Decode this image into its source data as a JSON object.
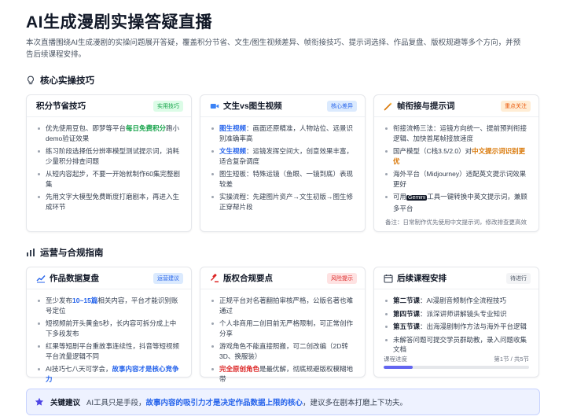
{
  "header": {
    "title": "AI生成漫剧实操答疑直播",
    "description": "本次直播围绕AI生成漫剧的实操问题展开答疑，覆盖积分节省、文生/图生视频差异、帧衔接技巧、提示词选择、作品复盘、版权规避等多个方向，并预告后续课程安排。"
  },
  "sections": [
    {
      "title": "核心实操技巧",
      "icon": "lightbulb-icon",
      "cards": [
        {
          "title": "积分节省技巧",
          "tag": "实用技巧",
          "items": [
            [
              "优先使用豆包、即梦等平台",
              {
                "hl": "每日免费积分"
              },
              "跑小demo验证效果"
            ],
            [
              "练习阶段选择低分辨率模型测试提示词，消耗少量积分排查问题"
            ],
            [
              "从短内容起步，不要一开始就制作60集完整剧集"
            ],
            [
              "先用文字大模型免费断度打磨剧本，再进入生成环节"
            ]
          ]
        },
        {
          "title": "文生vs图生视频",
          "tag": "核心差异",
          "items": [
            [
              {
                "hl": "图生视频"
              },
              "：画面还原精准，人物站位、远景识别准确率高"
            ],
            [
              {
                "hl": "文生视频"
              },
              "：运镜发挥空间大，创意效果丰富，适合复杂调度"
            ],
            [
              "图生短板：特殊运镜（鱼眼、一镜到底）表现较差"
            ],
            [
              "实操流程：先建图片资产→文生初版→图生修正穿帮片段"
            ]
          ]
        },
        {
          "title": "帧衔接与提示词",
          "tag": "重点关注",
          "items": [
            [
              "衔接流畅三法：运镜方向统一、提前预判衔接逻辑、加快首尾帧接放速度"
            ],
            [
              "国产模型（C栈3.5/2.0）对",
              {
                "hl": "中文提示词识别更优"
              }
            ],
            [
              "海外平台（Midjourney）适配英文提示词效果更好"
            ],
            [
              "可用",
              {
                "kbd": "Gemini"
              },
              "工具一键转换中英文提示词，兼顾多平台"
            ]
          ],
          "note": "备注：日常制作优先使用中文提示词，修改排查更高效"
        }
      ]
    },
    {
      "title": "运营与合规指南",
      "icon": "bar-chart-icon",
      "cards": [
        {
          "title": "作品数据复盘",
          "tag": "运营建议",
          "items": [
            [
              "至少发布",
              {
                "hl": "10~15篇"
              },
              "相关内容，平台才能识别账号定位"
            ],
            [
              "短视频前开头黄金5秒，长内容可拆分成上中下多段发布"
            ],
            [
              "红果等短剧平台重故事连续性，抖音等短视频平台流量逻辑不同"
            ],
            [
              "AI技巧七八天可学会，",
              {
                "hl": "故事内容才是核心竞争力"
              }
            ]
          ]
        },
        {
          "title": "版权合规要点",
          "tag": "风险提示",
          "items": [
            [
              "正规平台对名著翻拍审核严格，公版名著也难通过"
            ],
            [
              "个人非商用二创目前无严格限制，可正常创作分享"
            ],
            [
              "游戏角色不能直接照搬，可二创改编（2D转3D、换服装）"
            ],
            [
              {
                "hl": "完全原创角色"
              },
              "是最优解，彻底规避版权模糊地带"
            ]
          ]
        },
        {
          "title": "后续课程安排",
          "tag": "待进行",
          "items": [
            [
              {
                "hl": "第二节课"
              },
              "：AI漫剧音频制作全流程技巧"
            ],
            [
              {
                "hl": "第四节课"
              },
              "：派深讲师讲解镜头专业知识"
            ],
            [
              {
                "hl": "第五节课"
              },
              "：出海漫剧制作方法与海外平台逻辑"
            ],
            [
              "未解答问题可提交学员群助教，录入问题收集文档"
            ]
          ],
          "progress": {
            "label": "课程进度",
            "value_text": "第1节 / 共5节",
            "fraction": 0.2
          }
        }
      ]
    }
  ],
  "tip": {
    "label": "关键建议",
    "before": "AI工具只是手段，",
    "highlight": "故事内容的吸引力才是决定作品数据上限的核心",
    "after": "，建议多在剧本打磨上下功夫。"
  },
  "colors": {
    "green": "#16a34a",
    "blue": "#2563eb",
    "orange": "#ea580c",
    "red": "#dc2626",
    "indigo": "#6366f1"
  }
}
